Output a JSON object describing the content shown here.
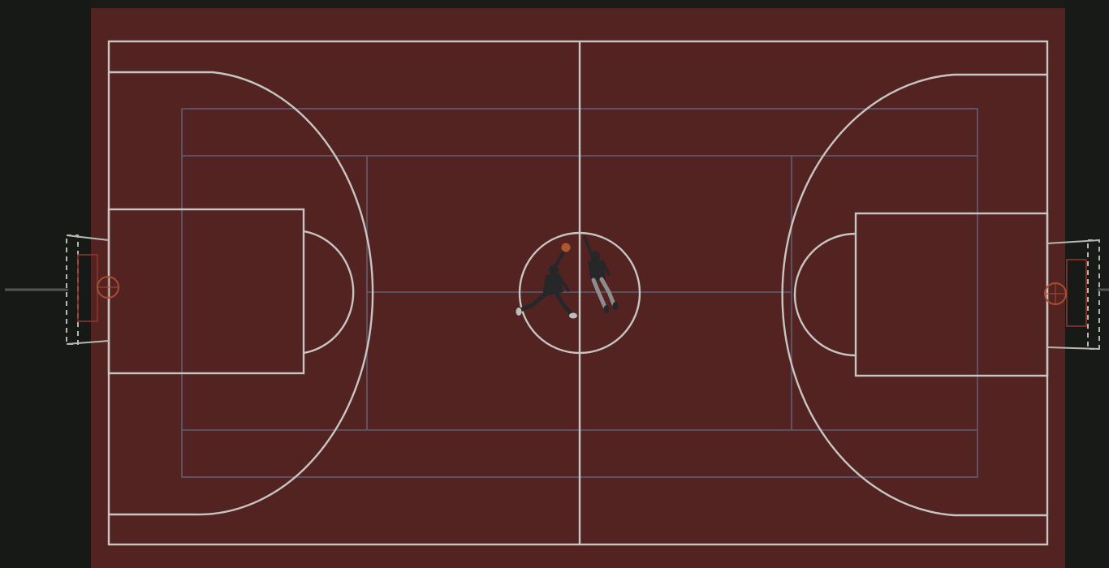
{
  "scene": {
    "subject": "basketball-court-aerial",
    "colors": {
      "surround": "#1d1e1b",
      "court_surface": "#5a2724",
      "court_surface_edge": "#4d2220",
      "white_lines": "#d9d6d3",
      "blue_lines": "#6e7694",
      "hoop_rim": "#b8543a",
      "ball": "#c0602e",
      "backboard_frame": "#c9c6c2",
      "player_dark": "#2b2b2d",
      "player_light": "#9a9a9a"
    }
  }
}
